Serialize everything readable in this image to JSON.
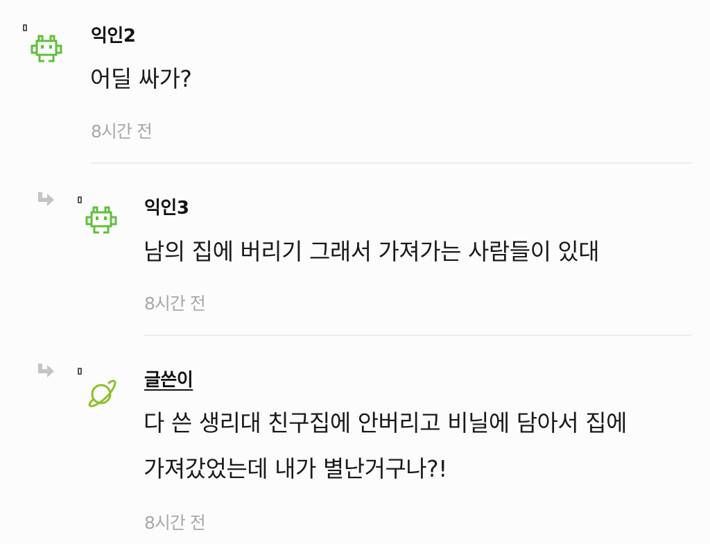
{
  "comments": [
    {
      "author": "익인2",
      "text_lines": [
        "어딜 싸가?"
      ],
      "time": "8시간 전",
      "avatar_icon": "space-invader-icon",
      "is_reply": false
    },
    {
      "author": "익인3",
      "text_lines": [
        "남의 집에 버리기 그래서 가져가는 사람들이 있대"
      ],
      "time": "8시간 전",
      "avatar_icon": "space-invader-icon",
      "is_reply": true
    },
    {
      "author": "글쓴이",
      "text_lines": [
        "다 쓴 생리대 친구집에 안버리고 비닐에 담아서 집에",
        "가져갔었는데 내가 별난거구나?!"
      ],
      "time": "8시간 전",
      "avatar_icon": "planet-icon",
      "is_reply": true,
      "is_original_poster": true
    }
  ],
  "colors": {
    "invader_green": "#5fbf3a",
    "planet_green": "#8cbf2a",
    "time_gray": "#a8a8a8",
    "arrow_gray": "#c4c4c4"
  }
}
